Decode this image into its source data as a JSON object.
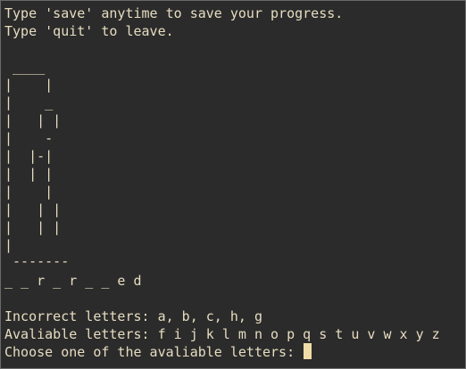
{
  "terminal": {
    "intro": [
      "Type 'save' anytime to save your progress.",
      "Type 'quit' to leave."
    ],
    "gallows": [
      " ____",
      "|    |",
      "|    _",
      "|   | |",
      "|    -",
      "|  |-|",
      "|  | |",
      "|    |",
      "|   | |",
      "|   | |",
      "|",
      " -------"
    ],
    "word_pattern": "_ _ r _ r _ _ e d",
    "incorrect_letters": "Incorrect letters: a, b, c, h, g",
    "available_letters": "Avaliable letters: f i j k l m n o p q s t u v w x y z",
    "prompt": "Choose one of the avaliable letters: ",
    "colors": {
      "background": "#2b2b2b",
      "text": "#e6dcc0",
      "cursor": "#f0dca8"
    }
  }
}
